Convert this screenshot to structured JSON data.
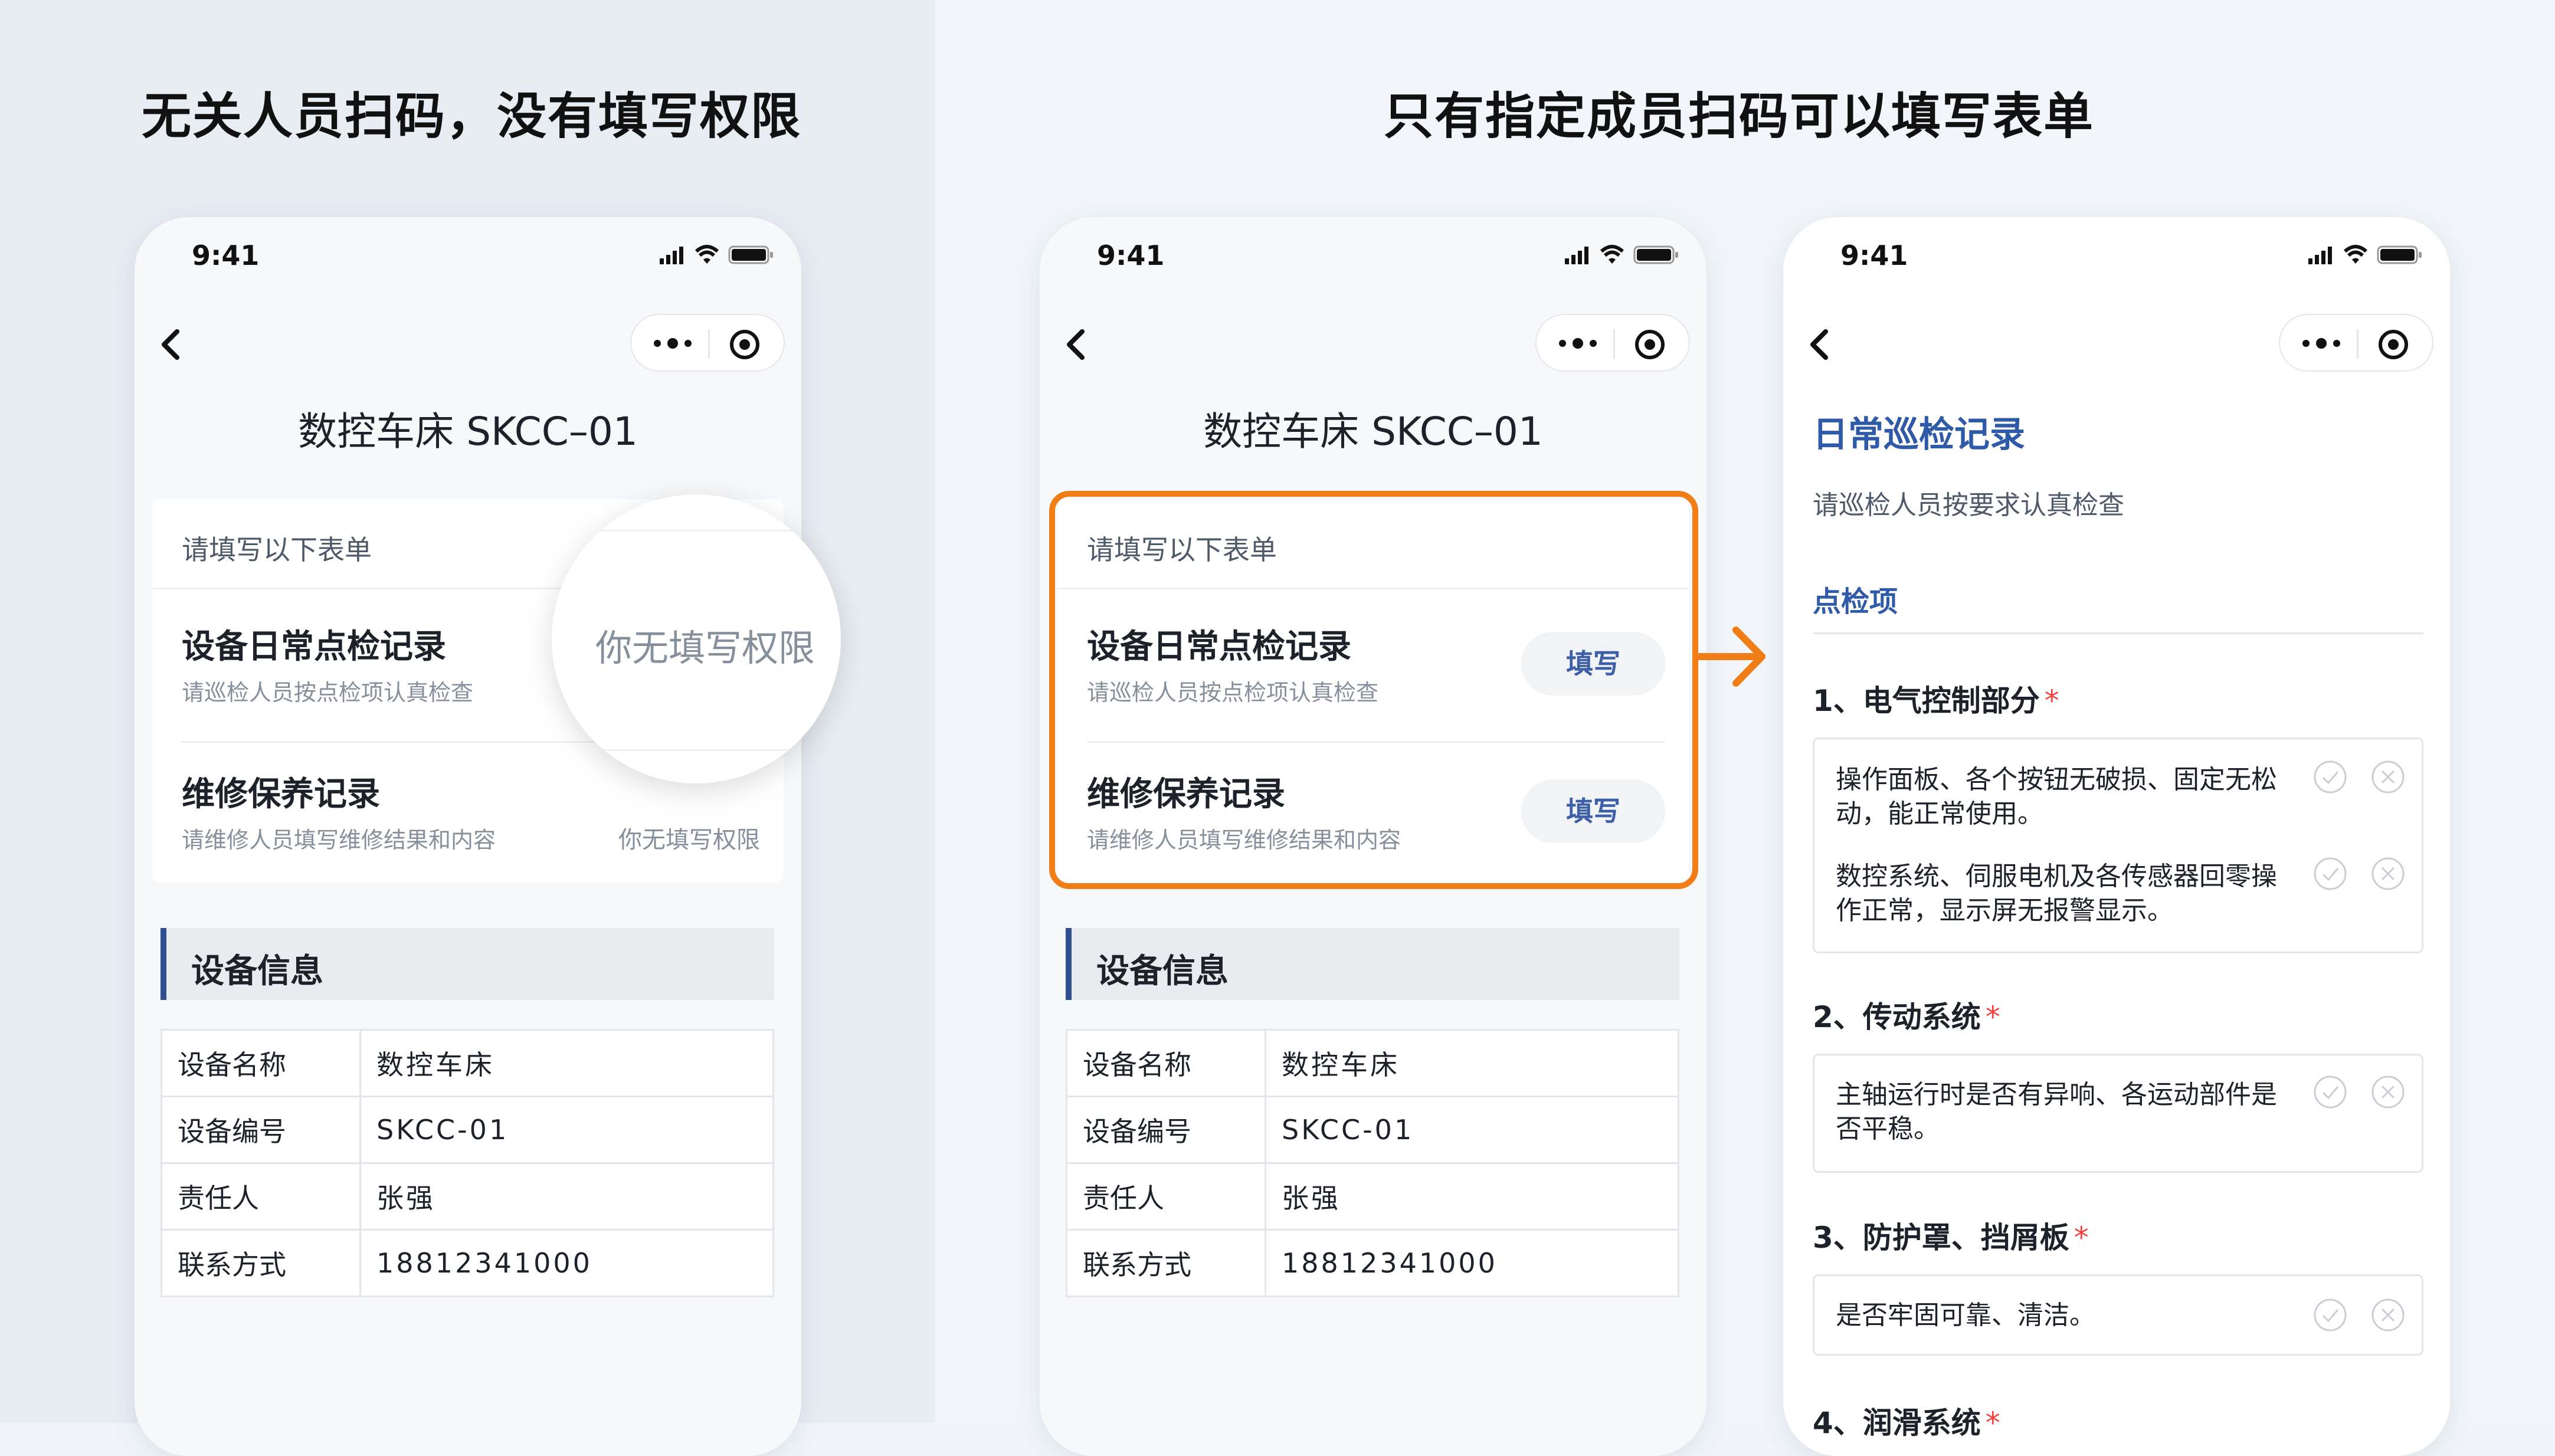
{
  "left_heading": "无关人员扫码，没有填写权限",
  "right_heading": "只有指定成员扫码可以填写表单",
  "status_time": "9:41",
  "device_page": {
    "title": "数控车床 SKCC–01",
    "form_header": "请填写以下表单",
    "forms": [
      {
        "title": "设备日常点检记录",
        "subtitle": "请巡检人员按点检项认真检查"
      },
      {
        "title": "维修保养记录",
        "subtitle": "请维修人员填写维修结果和内容"
      }
    ],
    "no_permission_label": "你无填写权限",
    "fill_button_label": "填写",
    "section_title": "设备信息",
    "info_rows": [
      {
        "key": "设备名称",
        "value": "数控车床"
      },
      {
        "key": "设备编号",
        "value": "SKCC-01"
      },
      {
        "key": "责任人",
        "value": "张强"
      },
      {
        "key": "联系方式",
        "value": "18812341000"
      }
    ]
  },
  "form_page": {
    "title": "日常巡检记录",
    "description": "请巡检人员按要求认真检查",
    "group_label": "点检项",
    "questions": [
      {
        "label": "1、电气控制部分",
        "options": [
          "操作面板、各个按钮无破损、固定无松动，能正常使用。",
          "数控系统、伺服电机及各传感器回零操作正常，显示屏无报警显示。"
        ]
      },
      {
        "label": "2、传动系统",
        "options": [
          "主轴运行时是否有异响、各运动部件是否平稳。"
        ]
      },
      {
        "label": "3、防护罩、挡屑板",
        "options": [
          "是否牢固可靠、清洁。"
        ]
      },
      {
        "label": "4、润滑系统",
        "options": []
      }
    ],
    "required_mark": "*"
  },
  "colors": {
    "accent_orange": "#f07d16",
    "brand_blue": "#2f5aa8",
    "required_red": "#f53f3f"
  },
  "icons": [
    "back-icon",
    "more-icon",
    "target-icon",
    "signal-icon",
    "wifi-icon",
    "battery-icon",
    "arrow-right-icon",
    "check-icon",
    "cross-icon"
  ]
}
